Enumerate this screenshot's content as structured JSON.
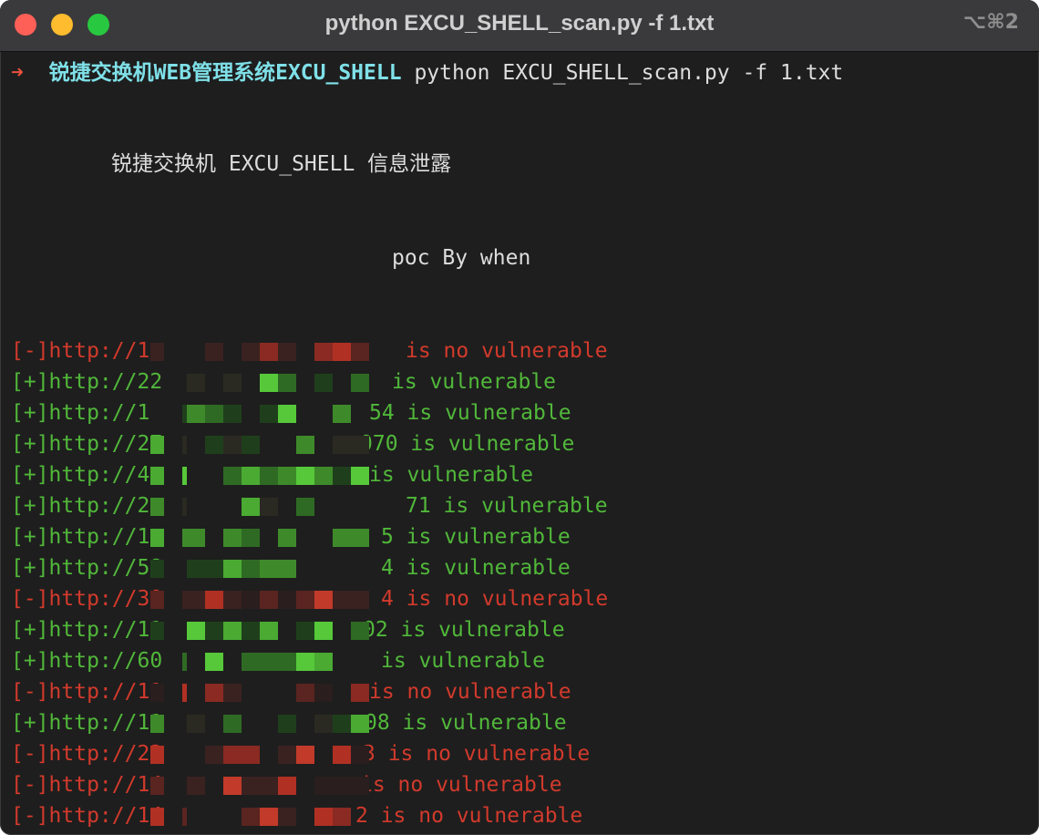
{
  "window": {
    "title": "python EXCU_SHELL_scan.py -f 1.txt",
    "shortcut": "⌥⌘2"
  },
  "prompt": {
    "arrow": "➜",
    "directory": "锐捷交换机WEB管理系统EXCU_SHELL",
    "command": "python EXCU_SHELL_scan.py -f 1.txt"
  },
  "banner": {
    "title": "锐捷交换机 EXCU_SHELL 信息泄露",
    "author": "poc By when"
  },
  "results": [
    {
      "status": "[-]",
      "url": "http://1",
      "tail": "   is no vulnerable",
      "vulnerable": false
    },
    {
      "status": "[+]",
      "url": "http://22",
      "tail": "  is vulnerable",
      "vulnerable": true
    },
    {
      "status": "[+]",
      "url": "http://1",
      "tail": "54 is vulnerable",
      "vulnerable": true
    },
    {
      "status": "[+]",
      "url": "http://27",
      "tail": "070 is vulnerable",
      "vulnerable": true
    },
    {
      "status": "[+]",
      "url": "http://4",
      "tail": " is vulnerable",
      "vulnerable": true
    },
    {
      "status": "[+]",
      "url": "http://2",
      "tail": "71 is vulnerable",
      "vulnerable": true
    },
    {
      "status": "[+]",
      "url": "http://1",
      "tail": "5 is vulnerable",
      "vulnerable": true
    },
    {
      "status": "[+]",
      "url": "http://58",
      "tail": "4 is vulnerable",
      "vulnerable": true
    },
    {
      "status": "[-]",
      "url": "http://30",
      "tail": "4 is no vulnerable",
      "vulnerable": false
    },
    {
      "status": "[+]",
      "url": "http://11",
      "tail": "02 is vulnerable",
      "vulnerable": true
    },
    {
      "status": "[+]",
      "url": "http://60",
      "tail": " is vulnerable",
      "vulnerable": true
    },
    {
      "status": "[-]",
      "url": "http://11",
      "tail": " is no vulnerable",
      "vulnerable": false
    },
    {
      "status": "[+]",
      "url": "http://11",
      "tail": "08 is vulnerable",
      "vulnerable": true
    },
    {
      "status": "[-]",
      "url": "http://22",
      "tail": "3 is no vulnerable",
      "vulnerable": false
    },
    {
      "status": "[-]",
      "url": "http://14",
      "tail": "is no vulnerable",
      "vulnerable": false
    },
    {
      "status": "[-]",
      "url": "http://14",
      "tail": "2 is no vulnerable",
      "vulnerable": false
    }
  ],
  "colors": {
    "vulnerable": "#51b83a",
    "not_vulnerable": "#d23a2c",
    "prompt_arrow": "#e8513c",
    "prompt_dir": "#7fe0e8"
  }
}
